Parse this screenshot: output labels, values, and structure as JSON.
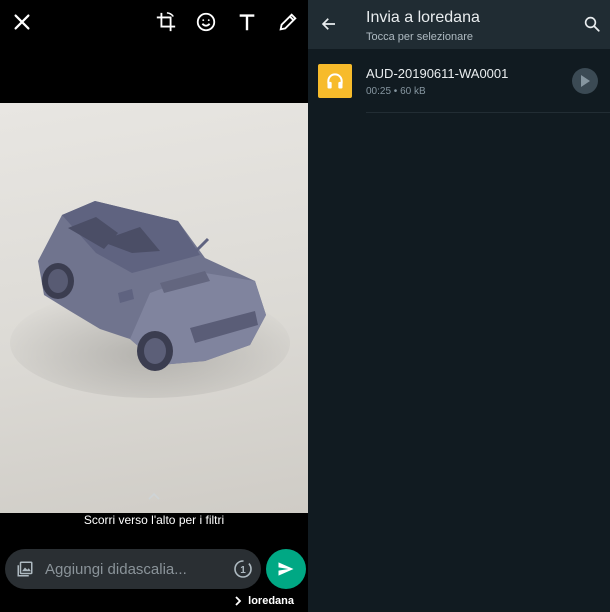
{
  "editor": {
    "tools": [
      "close-icon",
      "crop-rotate-icon",
      "emoji-icon",
      "text-icon",
      "pencil-icon"
    ],
    "filters_hint": "Scorri verso l'alto per i filtri",
    "caption_placeholder": "Aggiungi didascalia...",
    "timer_label": "1",
    "recipient": "loredana"
  },
  "send_to": {
    "title": "Invia a loredana",
    "subtitle": "Tocca per selezionare",
    "files": [
      {
        "name": "AUD-20190611-WA0001",
        "meta": "00:25 • 60 kB",
        "icon": "headphones-icon"
      }
    ]
  },
  "colors": {
    "send_accent": "#00a884",
    "header_bg": "#202c33",
    "list_bg": "#111b21",
    "audio_thumb": "#f7bb2b"
  }
}
